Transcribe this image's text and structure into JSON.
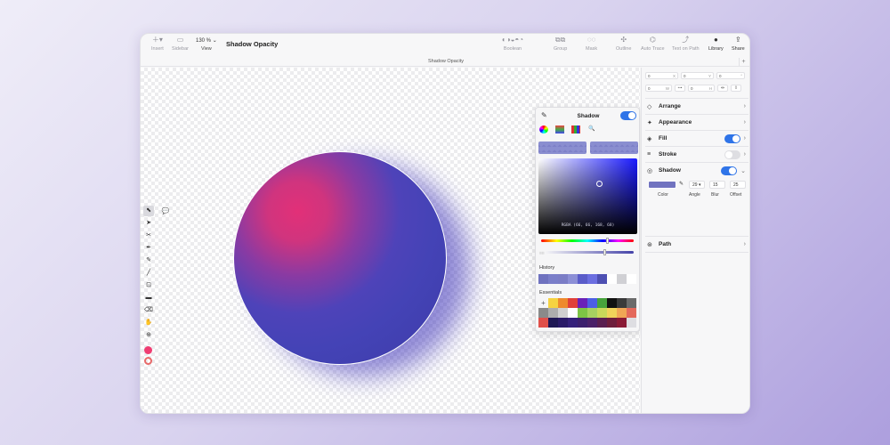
{
  "toolbar": {
    "insert": "Insert",
    "sidebar": "Sidebar",
    "zoom_value": "130 %",
    "zoom_label": "View",
    "doc_title": "Shadow Opacity",
    "boolean": "Boolean",
    "group": "Group",
    "mask": "Mask",
    "outline": "Outline",
    "auto_trace": "Auto Trace",
    "text_on_path": "Text on Path",
    "library": "Library",
    "share": "Share"
  },
  "subtitle": "Shadow Opacity",
  "picker": {
    "title": "Shadow",
    "sv_readout": "RGBA (66, 66, 168, 68)",
    "history_label": "History",
    "essentials_label": "Essentials",
    "history": [
      "#6f72bf",
      "#7a7ec9",
      "#7b7dc6",
      "#8c8fd6",
      "#5a5cc9",
      "#6b6ee0",
      "#4d4fb2",
      "#ffffff",
      "#d0d0d4",
      "#ffffff"
    ],
    "essentials": [
      "add",
      "#f5d341",
      "#ee8a2d",
      "#e0403a",
      "#6a21b8",
      "#4d5fe4",
      "#47a33c",
      "#111111",
      "#3a3a3a",
      "#6b6b6b",
      "#8a8a8a",
      "#adadad",
      "#d0d0d0",
      "#ffffff",
      "#7dc445",
      "#a6d160",
      "#c8d95a",
      "#f0d35a",
      "#f0a655",
      "#e4695c",
      "#e0504a",
      "#1f1855",
      "#2a1a68",
      "#35207a",
      "#3c1f6d",
      "#4a2068",
      "#5a1f50",
      "#6e1e3c",
      "#8a1a35",
      "#dedee2"
    ]
  },
  "panel": {
    "x": "0",
    "x_axis": "X",
    "y": "0",
    "y_axis": "Y",
    "r": "0",
    "r_axis": "°",
    "w": "0",
    "w_axis": "W",
    "h": "0",
    "h_axis": "H",
    "arrange": "Arrange",
    "appearance": "Appearance",
    "fill": "Fill",
    "stroke": "Stroke",
    "shadow": "Shadow",
    "path": "Path",
    "shadow_color_label": "Color",
    "angle_value": "29",
    "angle_label": "Angle",
    "blur_value": "15",
    "blur_label": "Blur",
    "offset_value": "25",
    "offset_label": "Offset",
    "fill_on": true,
    "stroke_on": false,
    "shadow_on": true
  },
  "colors": {
    "accent": "#2f74e8",
    "circle_pink": "#e23078",
    "circle_blue": "#4443b6",
    "shadow_color": "#7173c0",
    "tool_color": "#ef3d72"
  }
}
